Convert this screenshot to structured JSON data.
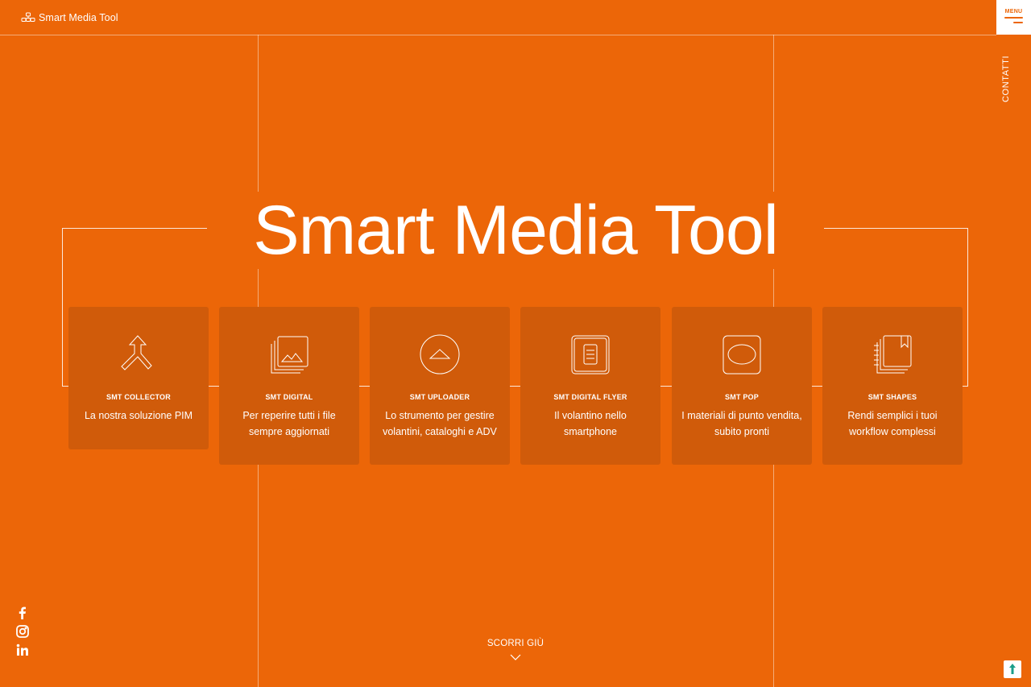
{
  "header": {
    "logo_text": "Smart Media Tool",
    "menu_label": "MENU",
    "contact_label": "CONTATTI"
  },
  "hero": {
    "title": "Smart Media Tool"
  },
  "products": [
    {
      "name": "SMT COLLECTOR",
      "description": "La nostra soluzione PIM",
      "icon": "merge-arrows-icon"
    },
    {
      "name": "SMT DIGITAL",
      "description": "Per reperire tutti i file sempre aggiornati",
      "icon": "image-stack-icon"
    },
    {
      "name": "SMT UPLOADER",
      "description": "Lo strumento per gestire volantini, cataloghi e ADV",
      "icon": "upload-circle-icon"
    },
    {
      "name": "SMT DIGITAL FLYER",
      "description": "Il volantino nello smartphone",
      "icon": "smartphone-icon"
    },
    {
      "name": "SMT POP",
      "description": "I materiali di punto vendita, subito pronti",
      "icon": "pop-display-icon"
    },
    {
      "name": "SMT SHAPES",
      "description": "Rendi semplici i tuoi workflow complessi",
      "icon": "notebook-icon"
    }
  ],
  "social": [
    "facebook-icon",
    "instagram-icon",
    "linkedin-icon"
  ],
  "scroll": {
    "label": "SCORRI GIÙ"
  },
  "colors": {
    "background": "#ec6608",
    "card": "#d05b0a",
    "text": "#ffffff",
    "accent": "#1a9e8a"
  }
}
